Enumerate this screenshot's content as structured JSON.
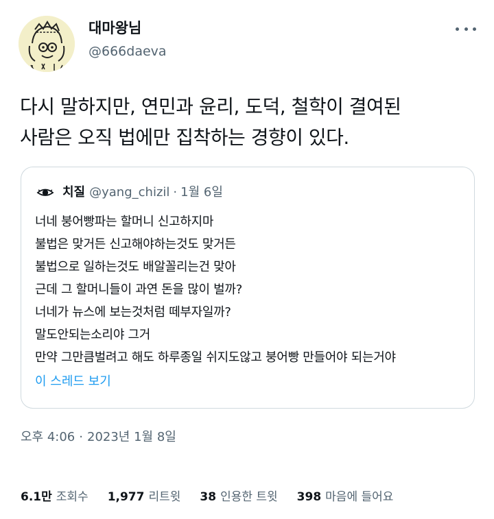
{
  "author": {
    "display_name": "대마왕님",
    "handle": "@666daeva"
  },
  "tweet": {
    "lines": [
      "다시 말하지만, 연민과 윤리, 도덕, 철학이 결여된",
      "사람은 오직 법에만 집착하는 경향이 있다."
    ]
  },
  "quote": {
    "name": "치질",
    "handle": "@yang_chizil",
    "separator": "·",
    "date": "1월 6일",
    "lines": [
      "너네 붕어빵파는 할머니 신고하지마",
      "불법은 맞거든 신고해야하는것도 맞거든",
      "불법으로 일하는것도 배알꼴리는건 맞아",
      "근데 그 할머니들이 과연 돈을 많이 벌까?",
      "너네가 뉴스에 보는것처럼 떼부자일까?",
      "말도안되는소리야 그거",
      "만약 그만큼벌려고 해도 하루종일 쉬지도않고 붕어빵 만들어야 되는거야"
    ],
    "thread_link": "이 스레드 보기"
  },
  "timestamp": {
    "time": "오후 4:06",
    "separator": "·",
    "date": "2023년 1월 8일"
  },
  "stats": [
    {
      "value": "6.1만",
      "label": "조회수"
    },
    {
      "value": "1,977",
      "label": "리트윗"
    },
    {
      "value": "38",
      "label": "인용한 트윗"
    },
    {
      "value": "398",
      "label": "마음에 들어요"
    }
  ],
  "colors": {
    "text": "#0f1419",
    "secondary": "#536471",
    "link": "#1d9bf0",
    "border": "#cfd9de"
  },
  "icons": {
    "more": "more-horizontal-icon",
    "quote_avatar": "eye-avatar-icon"
  }
}
